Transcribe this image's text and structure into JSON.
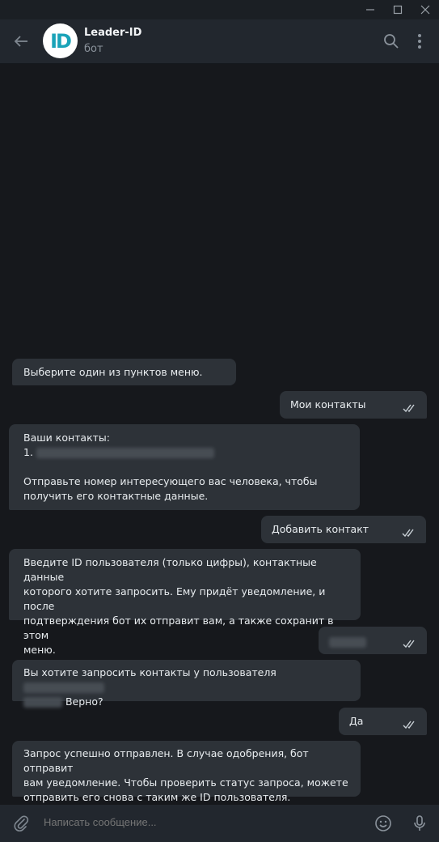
{
  "window": {
    "minimize": "—",
    "maximize": "☐",
    "close": "✕"
  },
  "header": {
    "avatar_text": "ID",
    "title": "Leader-ID",
    "subtitle": "бот"
  },
  "messages": [
    {
      "dir": "in",
      "text": "Выберите один из пунктов меню."
    },
    {
      "dir": "out",
      "text": "Мои контакты"
    },
    {
      "dir": "in",
      "line1": "Ваши контакты:",
      "line2": "1.",
      "line3": "Отправьте номер интересующего вас человека, чтобы",
      "line4": "получить его контактные данные."
    },
    {
      "dir": "out",
      "text": "Добавить контакт"
    },
    {
      "dir": "in",
      "line1": "Введите ID пользователя (только цифры), контактные данные",
      "line2": "которого хотите запросить. Ему придёт уведомление, и после",
      "line3": "подтверждения бот их отправит вам, а также сохранит в этом",
      "line4": "меню."
    },
    {
      "dir": "out",
      "text": ""
    },
    {
      "dir": "in",
      "line1": "Вы хотите запросить контакты у пользователя",
      "line2": "Верно?"
    },
    {
      "dir": "out",
      "text": "Да"
    },
    {
      "dir": "in",
      "line1": "Запрос успешно отправлен. В случае одобрения, бот отправит",
      "line2": "вам уведомление. Чтобы проверить статус запроса, можете",
      "line3": "отправить его снова с таким же ID пользователя."
    }
  ],
  "composer": {
    "placeholder": "Написать сообщение..."
  },
  "colors": {
    "background": "#16181c",
    "bubble": "#2d3238",
    "header": "#22272e",
    "accent": "#1aa3b8"
  }
}
